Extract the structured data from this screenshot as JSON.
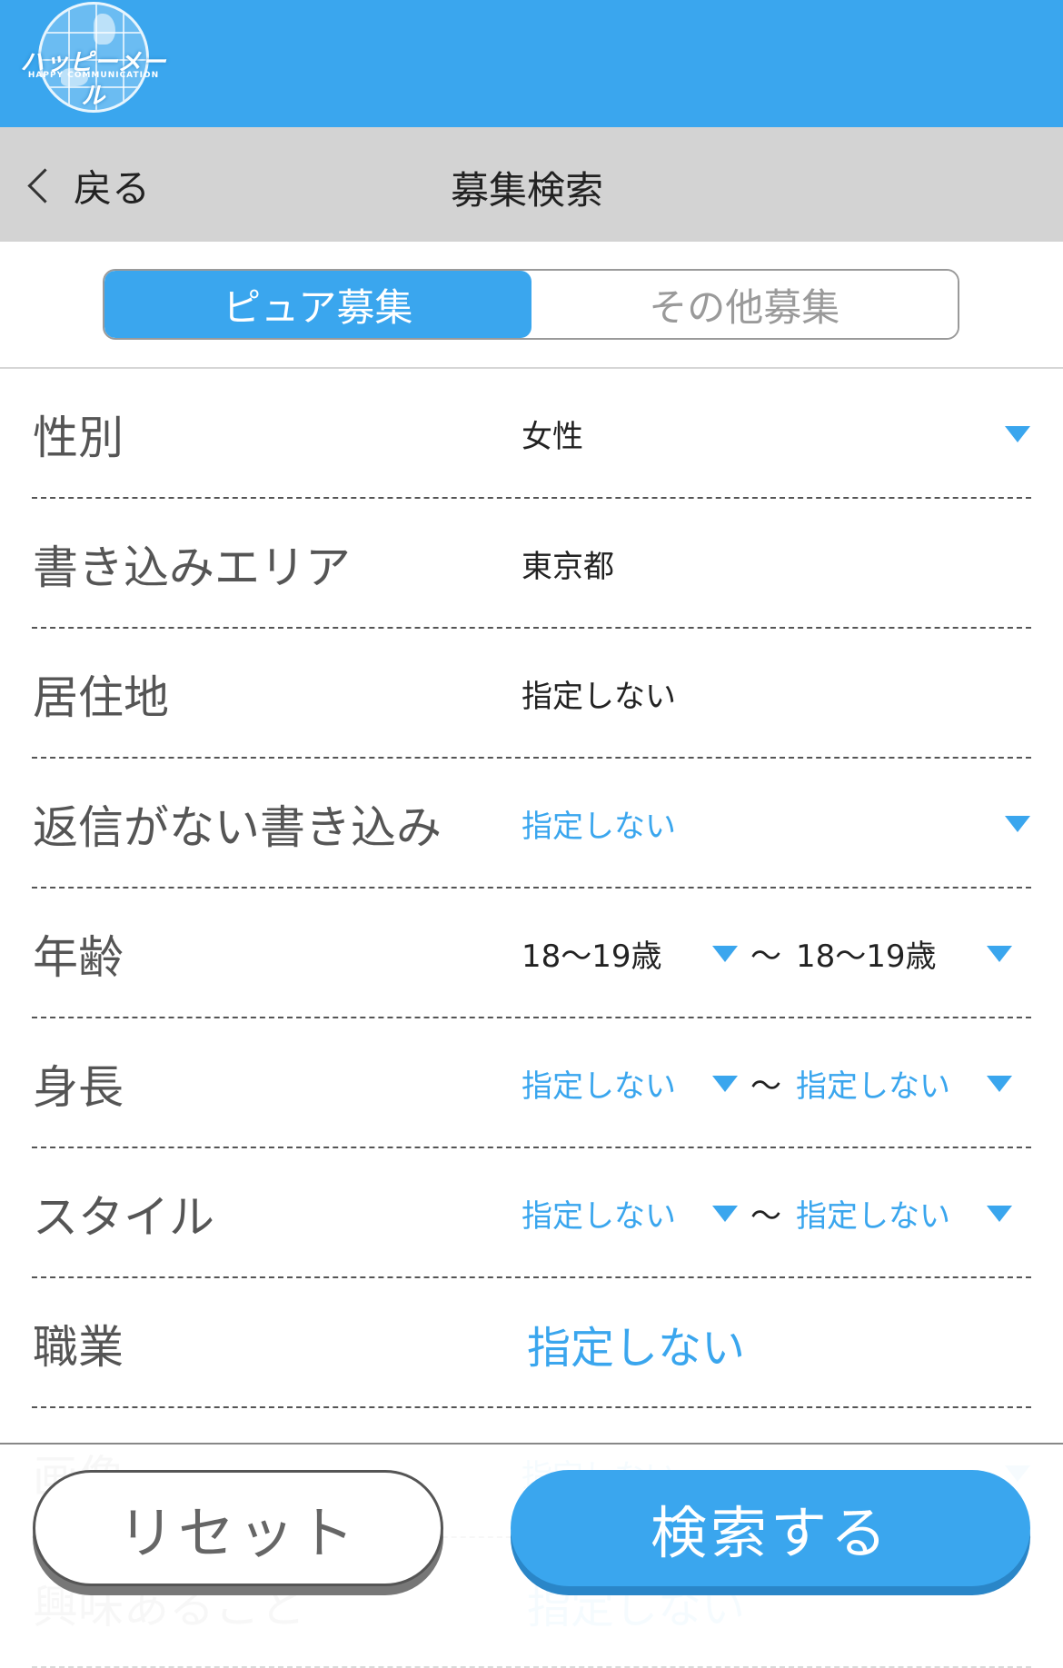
{
  "header": {
    "logo_text": "ハッピーメール",
    "logo_sub": "HAPPY COMMUNICATION"
  },
  "navbar": {
    "back_label": "戻る",
    "title": "募集検索"
  },
  "tabs": [
    {
      "label": "ピュア募集",
      "active": true
    },
    {
      "label": "その他募集",
      "active": false
    }
  ],
  "fields": {
    "gender": {
      "label": "性別",
      "value": "女性"
    },
    "post_area": {
      "label": "書き込みエリア",
      "value": "東京都"
    },
    "residence": {
      "label": "居住地",
      "value": "指定しない"
    },
    "no_reply": {
      "label": "返信がない書き込み",
      "value": "指定しない"
    },
    "age": {
      "label": "年齢",
      "from": "18〜19歳",
      "to": "18〜19歳",
      "separator": "〜"
    },
    "height": {
      "label": "身長",
      "from": "指定しない",
      "to": "指定しない",
      "separator": "〜"
    },
    "style": {
      "label": "スタイル",
      "from": "指定しない",
      "to": "指定しない",
      "separator": "〜"
    },
    "occupation": {
      "label": "職業",
      "value": "指定しない"
    },
    "image": {
      "label": "画像",
      "value": "指定しない"
    },
    "interests": {
      "label": "興味あること",
      "value": "指定しない"
    }
  },
  "buttons": {
    "reset": "リセット",
    "search": "検索する"
  },
  "colors": {
    "accent": "#3aa6ee",
    "nav_bg": "#d3d3d3"
  }
}
